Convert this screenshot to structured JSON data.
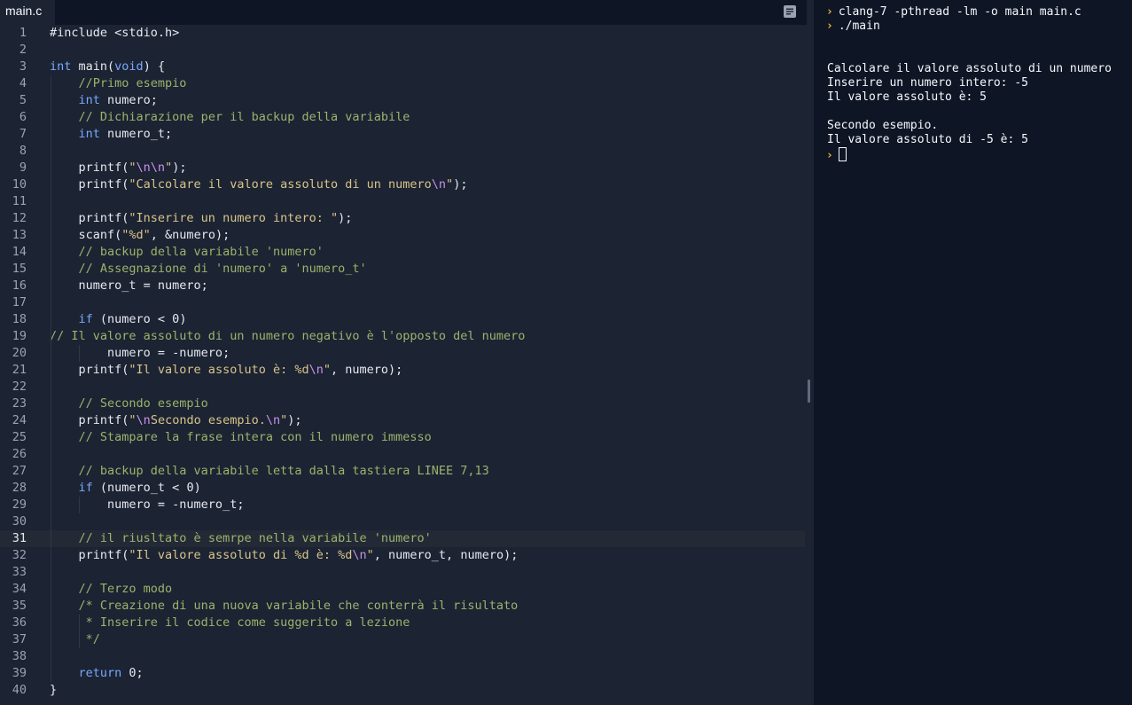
{
  "editor": {
    "tab_label": "main.c",
    "active_line": 31,
    "lines": [
      {
        "n": "1",
        "t": [
          [
            "#include <stdio.h>",
            "src"
          ]
        ]
      },
      {
        "n": "2",
        "t": []
      },
      {
        "n": "3",
        "t": [
          [
            "int",
            "kw"
          ],
          [
            " main(",
            "src"
          ],
          [
            "void",
            "kw"
          ],
          [
            ") {",
            "src"
          ]
        ]
      },
      {
        "n": "4",
        "t": [
          [
            "    ",
            "src"
          ],
          [
            "//Primo esempio",
            "cm"
          ]
        ]
      },
      {
        "n": "5",
        "t": [
          [
            "    ",
            "src"
          ],
          [
            "int",
            "kw"
          ],
          [
            " numero;",
            "src"
          ]
        ]
      },
      {
        "n": "6",
        "t": [
          [
            "    ",
            "src"
          ],
          [
            "// Dichiarazione per il backup della variabile",
            "cm"
          ]
        ]
      },
      {
        "n": "7",
        "t": [
          [
            "    ",
            "src"
          ],
          [
            "int",
            "kw"
          ],
          [
            " numero_t;",
            "src"
          ]
        ]
      },
      {
        "n": "8",
        "t": []
      },
      {
        "n": "9",
        "t": [
          [
            "    printf(",
            "src"
          ],
          [
            "\"",
            "st"
          ],
          [
            "\\n\\n",
            "es"
          ],
          [
            "\"",
            "st"
          ],
          [
            ");",
            "src"
          ]
        ]
      },
      {
        "n": "10",
        "t": [
          [
            "    printf(",
            "src"
          ],
          [
            "\"Calcolare il valore assoluto di un numero",
            "st"
          ],
          [
            "\\n",
            "es"
          ],
          [
            "\"",
            "st"
          ],
          [
            ");",
            "src"
          ]
        ]
      },
      {
        "n": "11",
        "t": []
      },
      {
        "n": "12",
        "t": [
          [
            "    printf(",
            "src"
          ],
          [
            "\"Inserire un numero intero: \"",
            "st"
          ],
          [
            ");",
            "src"
          ]
        ]
      },
      {
        "n": "13",
        "t": [
          [
            "    scanf(",
            "src"
          ],
          [
            "\"%d\"",
            "st"
          ],
          [
            ", &numero);",
            "src"
          ]
        ]
      },
      {
        "n": "14",
        "t": [
          [
            "    ",
            "src"
          ],
          [
            "// backup della variabile 'numero'",
            "cm"
          ]
        ]
      },
      {
        "n": "15",
        "t": [
          [
            "    ",
            "src"
          ],
          [
            "// Assegnazione di 'numero' a 'numero_t'",
            "cm"
          ]
        ]
      },
      {
        "n": "16",
        "t": [
          [
            "    numero_t = numero;",
            "src"
          ]
        ]
      },
      {
        "n": "17",
        "t": []
      },
      {
        "n": "18",
        "t": [
          [
            "    ",
            "src"
          ],
          [
            "if",
            "kw"
          ],
          [
            " (numero < 0)",
            "src"
          ]
        ]
      },
      {
        "n": "19",
        "t": [
          [
            "// Il valore assoluto di un numero negativo è l'opposto del numero",
            "cm"
          ]
        ]
      },
      {
        "n": "20",
        "t": [
          [
            "        numero = -numero;",
            "src"
          ]
        ]
      },
      {
        "n": "21",
        "t": [
          [
            "    printf(",
            "src"
          ],
          [
            "\"Il valore assoluto è: %d",
            "st"
          ],
          [
            "\\n",
            "es"
          ],
          [
            "\"",
            "st"
          ],
          [
            ", numero);",
            "src"
          ]
        ]
      },
      {
        "n": "22",
        "t": []
      },
      {
        "n": "23",
        "t": [
          [
            "    ",
            "src"
          ],
          [
            "// Secondo esempio",
            "cm"
          ]
        ]
      },
      {
        "n": "24",
        "t": [
          [
            "    printf(",
            "src"
          ],
          [
            "\"",
            "st"
          ],
          [
            "\\n",
            "es"
          ],
          [
            "Secondo esempio.",
            "st"
          ],
          [
            "\\n",
            "es"
          ],
          [
            "\"",
            "st"
          ],
          [
            ");",
            "src"
          ]
        ]
      },
      {
        "n": "25",
        "t": [
          [
            "    ",
            "src"
          ],
          [
            "// Stampare la frase intera con il numero immesso",
            "cm"
          ]
        ]
      },
      {
        "n": "26",
        "t": []
      },
      {
        "n": "27",
        "t": [
          [
            "    ",
            "src"
          ],
          [
            "// backup della variabile letta dalla tastiera LINEE 7,13",
            "cm"
          ]
        ]
      },
      {
        "n": "28",
        "t": [
          [
            "    ",
            "src"
          ],
          [
            "if",
            "kw"
          ],
          [
            " (numero_t < 0)",
            "src"
          ]
        ]
      },
      {
        "n": "29",
        "t": [
          [
            "        numero = -numero_t;",
            "src"
          ]
        ]
      },
      {
        "n": "30",
        "t": []
      },
      {
        "n": "31",
        "t": [
          [
            "    ",
            "src"
          ],
          [
            "// il riusltato è semrpe nella variabile 'numero'",
            "cm"
          ]
        ]
      },
      {
        "n": "32",
        "t": [
          [
            "    printf(",
            "src"
          ],
          [
            "\"Il valore assoluto di %d è: %d",
            "st"
          ],
          [
            "\\n",
            "es"
          ],
          [
            "\"",
            "st"
          ],
          [
            ", numero_t, numero);",
            "src"
          ]
        ]
      },
      {
        "n": "33",
        "t": []
      },
      {
        "n": "34",
        "t": [
          [
            "    ",
            "src"
          ],
          [
            "// Terzo modo",
            "cm"
          ]
        ]
      },
      {
        "n": "35",
        "t": [
          [
            "    ",
            "src"
          ],
          [
            "/* Creazione di una nuova variabile che conterrà il risultato",
            "cm"
          ]
        ]
      },
      {
        "n": "36",
        "t": [
          [
            "     ",
            "src"
          ],
          [
            "* Inserire il codice come suggerito a lezione",
            "cm"
          ]
        ]
      },
      {
        "n": "37",
        "t": [
          [
            "     ",
            "src"
          ],
          [
            "*/",
            "cm"
          ]
        ]
      },
      {
        "n": "38",
        "t": []
      },
      {
        "n": "39",
        "t": [
          [
            "    ",
            "src"
          ],
          [
            "return",
            "kw"
          ],
          [
            " 0;",
            "src"
          ]
        ]
      },
      {
        "n": "40",
        "t": [
          [
            "}",
            "src"
          ]
        ]
      }
    ]
  },
  "console": {
    "lines": [
      {
        "prompt": true,
        "text": "clang-7 -pthread -lm -o main main.c"
      },
      {
        "prompt": true,
        "text": "./main"
      },
      {
        "prompt": false,
        "text": ""
      },
      {
        "prompt": false,
        "text": ""
      },
      {
        "prompt": false,
        "text": "Calcolare il valore assoluto di un numero"
      },
      {
        "prompt": false,
        "text": "Inserire un numero intero: -5"
      },
      {
        "prompt": false,
        "text": "Il valore assoluto è: 5"
      },
      {
        "prompt": false,
        "text": ""
      },
      {
        "prompt": false,
        "text": "Secondo esempio."
      },
      {
        "prompt": false,
        "text": "Il valore assoluto di -5 è: 5"
      },
      {
        "prompt": true,
        "text": "",
        "cursor": true
      }
    ]
  },
  "icons": {
    "format": "format-code-icon",
    "prompt": "prompt-chevron-icon"
  },
  "colors": {
    "keyword": "#78a9ff",
    "comment": "#9ab46b",
    "string": "#d8c58a",
    "escape": "#c792ea",
    "prompt": "#f0b537"
  }
}
